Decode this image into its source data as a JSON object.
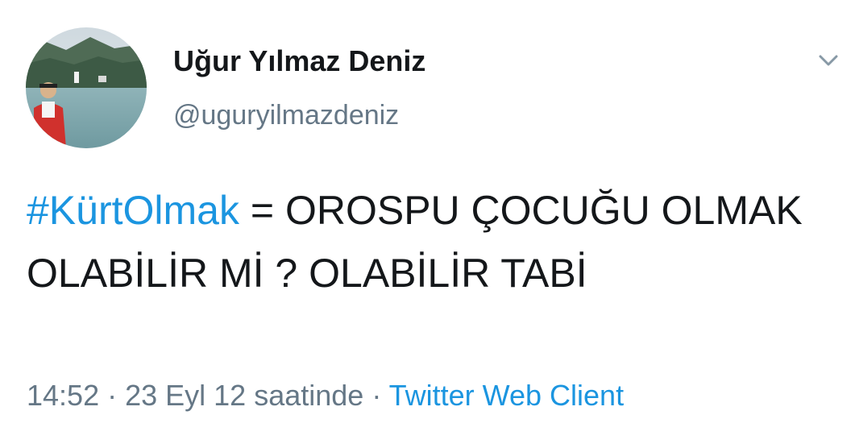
{
  "user": {
    "display_name": "Uğur Yılmaz Deniz",
    "handle": "@uguryilmazdeniz"
  },
  "tweet": {
    "hashtag": "#KürtOlmak",
    "text": " = OROSPU ÇOCUĞU OLMAK OLABİLİR Mİ ? OLABİLİR TABİ"
  },
  "meta": {
    "time": "14:52",
    "separator_1": " · ",
    "date": "23 Eyl 12 saatinde",
    "separator_2": " · ",
    "source": "Twitter Web Client"
  },
  "icons": {
    "menu": "chevron-down-icon"
  },
  "colors": {
    "link": "#1b95e0",
    "secondary_text": "#657786",
    "primary_text": "#14171a"
  }
}
